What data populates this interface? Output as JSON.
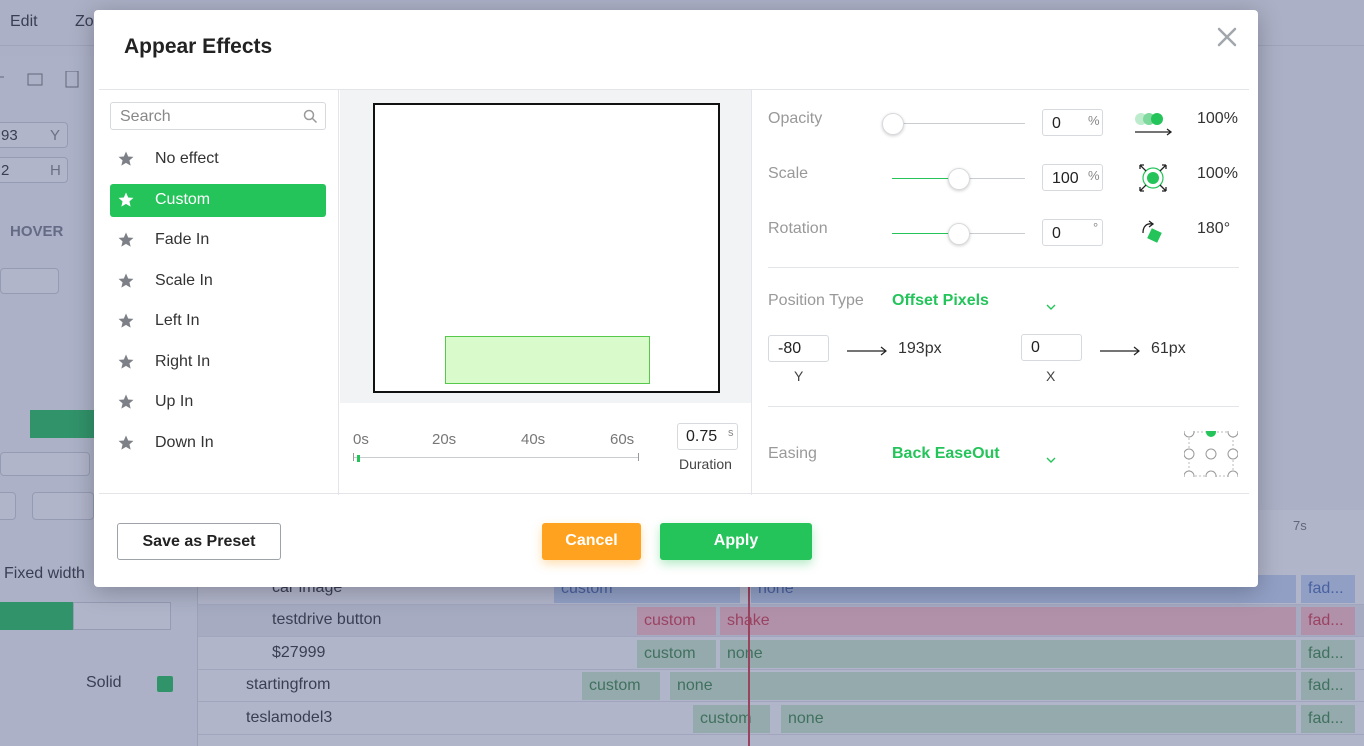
{
  "background": {
    "menu": [
      "Edit",
      "Zo"
    ],
    "left_fields": [
      {
        "value": "93",
        "axis": "Y"
      },
      {
        "value": "2",
        "axis": "H"
      }
    ],
    "hover_label": "HOVER",
    "fixed_width_label": "Fixed width",
    "solid_label": "Solid",
    "timeline_tick": "7s",
    "timeline_rows": [
      {
        "name": "car image",
        "appear": "custom",
        "main": "none",
        "exit": "fad..."
      },
      {
        "name": "testdrive button",
        "appear": "custom",
        "main": "shake",
        "exit": "fad..."
      },
      {
        "name": "$27999",
        "appear": "custom",
        "main": "none",
        "exit": "fad..."
      },
      {
        "name": "startingfrom",
        "appear": "custom",
        "main": "none",
        "exit": "fad..."
      },
      {
        "name": "teslamodel3",
        "appear": "custom",
        "main": "none",
        "exit": "fad..."
      }
    ]
  },
  "modal": {
    "title": "Appear Effects",
    "search_placeholder": "Search",
    "effects": [
      "No effect",
      "Custom",
      "Fade In",
      "Scale In",
      "Left In",
      "Right In",
      "Up In",
      "Down In"
    ],
    "selected_effect": "Custom",
    "preview": {
      "time_labels": [
        "0s",
        "20s",
        "40s",
        "60s"
      ],
      "duration_value": "0.75",
      "duration_unit": "s",
      "duration_label": "Duration"
    },
    "properties": {
      "opacity": {
        "label": "Opacity",
        "value": "0",
        "unit": "%",
        "target": "100%",
        "slider": 0.0
      },
      "scale": {
        "label": "Scale",
        "value": "100",
        "unit": "%",
        "target": "100%",
        "slider": 0.5
      },
      "rotation": {
        "label": "Rotation",
        "value": "0",
        "unit": "°",
        "target": "180°",
        "slider": 0.5
      },
      "position_type": {
        "label": "Position Type",
        "value": "Offset Pixels"
      },
      "position": {
        "y_value": "-80",
        "y_result": "193px",
        "y_label": "Y",
        "x_value": "0",
        "x_result": "61px",
        "x_label": "X"
      },
      "easing": {
        "label": "Easing",
        "value": "Back EaseOut"
      }
    },
    "buttons": {
      "save_preset": "Save as Preset",
      "cancel": "Cancel",
      "apply": "Apply"
    }
  },
  "colors": {
    "accent_green": "#24c45a",
    "cancel_orange": "#ffa21f",
    "timeline_red": "#d83a4a"
  }
}
